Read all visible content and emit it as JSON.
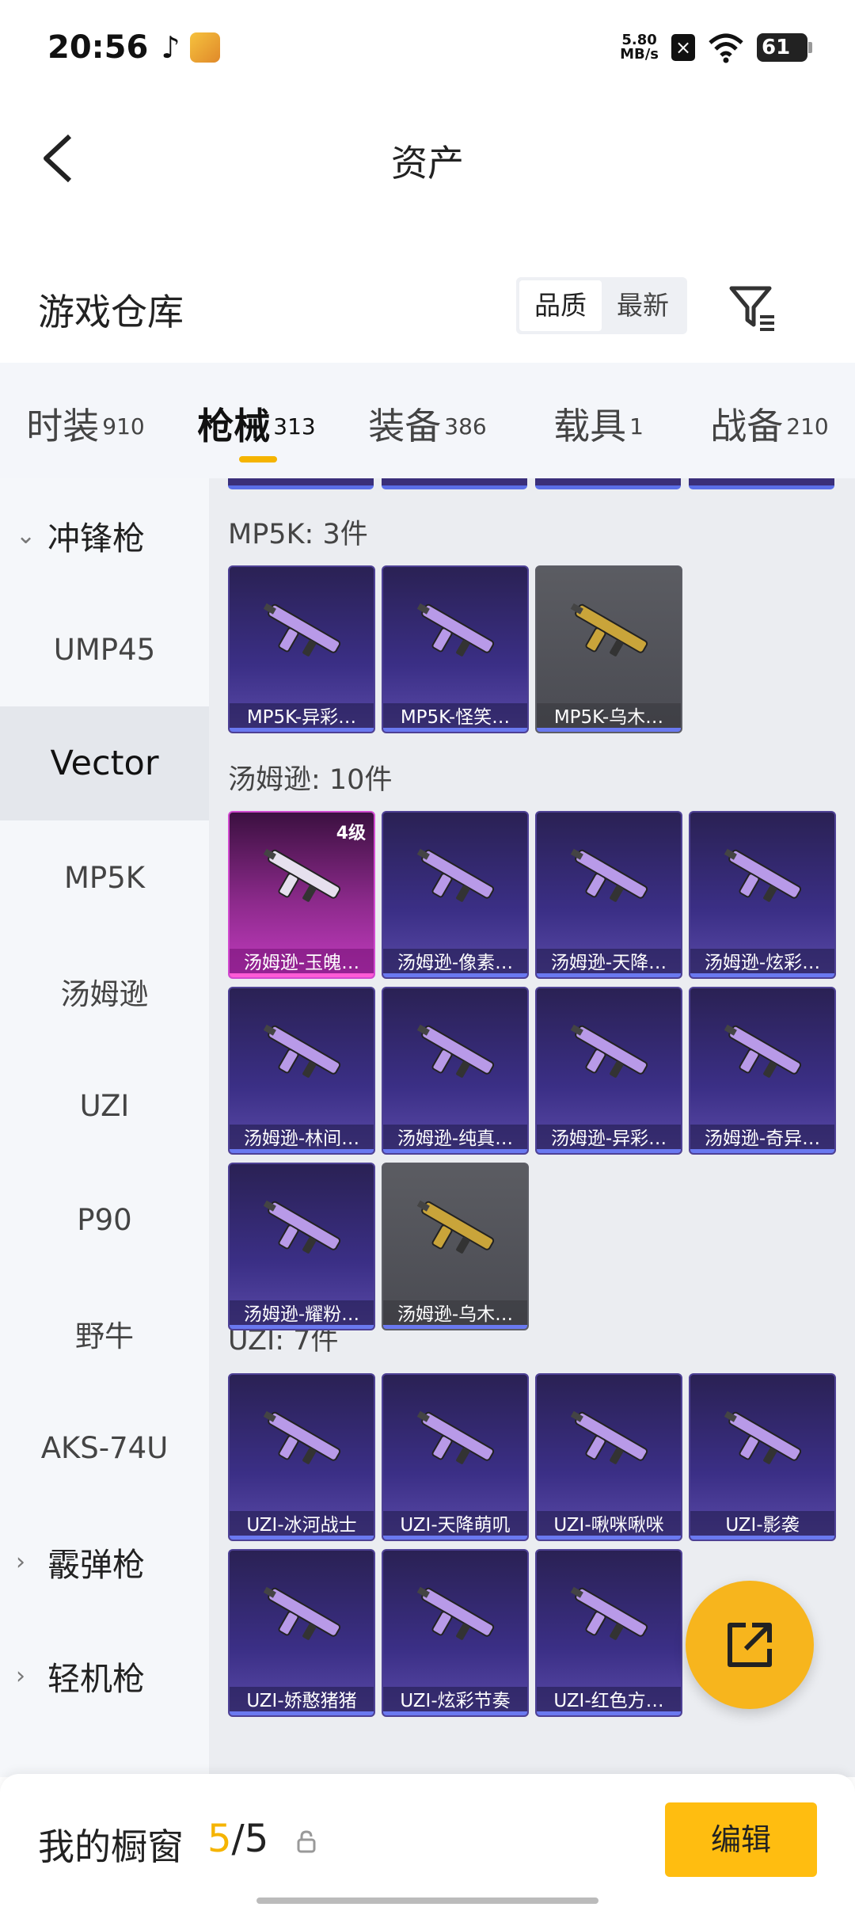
{
  "status_bar": {
    "time": "20:56",
    "net_speed_value": "5.80",
    "net_speed_unit": "MB/s",
    "battery": "61",
    "icons": [
      "tiktok-icon",
      "app-icon",
      "sim-icon",
      "wifi-icon",
      "battery-icon"
    ]
  },
  "header": {
    "title": "资产"
  },
  "warehouse": {
    "title": "游戏仓库",
    "sort_options": [
      "品质",
      "最新"
    ],
    "sort_selected": "品质"
  },
  "tabs": [
    {
      "label": "时装",
      "count": "910"
    },
    {
      "label": "枪械",
      "count": "313",
      "active": true
    },
    {
      "label": "装备",
      "count": "386"
    },
    {
      "label": "载具",
      "count": "1"
    },
    {
      "label": "战备",
      "count": "210"
    }
  ],
  "sidebar": {
    "groups": [
      {
        "label": "冲锋枪",
        "expanded": true
      },
      {
        "label": "霰弹枪",
        "expanded": false
      },
      {
        "label": "轻机枪",
        "expanded": false
      }
    ],
    "items": [
      "UMP45",
      "Vector",
      "MP5K",
      "汤姆逊",
      "UZI",
      "P90",
      "野牛",
      "AKS-74U"
    ],
    "selected": "Vector"
  },
  "sections": [
    {
      "title": "MP5K: 3件",
      "items": [
        {
          "name": "MP5K-异彩…",
          "style": "purple"
        },
        {
          "name": "MP5K-怪笑…",
          "style": "purple"
        },
        {
          "name": "MP5K-乌木…",
          "style": "grey"
        }
      ]
    },
    {
      "title": "汤姆逊: 10件",
      "items": [
        {
          "name": "汤姆逊-玉魄…",
          "style": "pink",
          "level": "4级"
        },
        {
          "name": "汤姆逊-像素…",
          "style": "purple"
        },
        {
          "name": "汤姆逊-天降…",
          "style": "purple"
        },
        {
          "name": "汤姆逊-炫彩…",
          "style": "purple"
        },
        {
          "name": "汤姆逊-林间…",
          "style": "purple"
        },
        {
          "name": "汤姆逊-纯真…",
          "style": "purple"
        },
        {
          "name": "汤姆逊-异彩…",
          "style": "purple"
        },
        {
          "name": "汤姆逊-奇异…",
          "style": "purple"
        },
        {
          "name": "汤姆逊-耀粉…",
          "style": "purple"
        },
        {
          "name": "汤姆逊-乌木…",
          "style": "grey"
        }
      ]
    },
    {
      "title": "UZI: 7件",
      "items": [
        {
          "name": "UZI-冰河战士",
          "style": "purple"
        },
        {
          "name": "UZI-天降萌叽",
          "style": "purple"
        },
        {
          "name": "UZI-啾咪啾咪",
          "style": "purple"
        },
        {
          "name": "UZI-影袭",
          "style": "purple"
        },
        {
          "name": "UZI-娇憨猪猪",
          "style": "purple"
        },
        {
          "name": "UZI-炫彩节奏",
          "style": "purple"
        },
        {
          "name": "UZI-红色方…",
          "style": "purple"
        }
      ]
    }
  ],
  "bottom_bar": {
    "title": "我的橱窗",
    "current": "5",
    "separator": "/",
    "total": "5",
    "edit_label": "编辑"
  },
  "colors": {
    "accent": "#f5b400",
    "edit_button": "#ffbd10",
    "card_purple": "#3b2f86",
    "card_pink": "#c23bbf",
    "card_grey": "#55565c"
  }
}
